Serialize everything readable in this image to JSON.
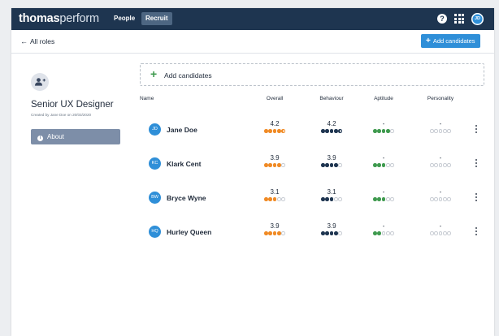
{
  "header": {
    "brand_bold": "thomas",
    "brand_light": "perform",
    "nav_people": "People",
    "nav_recruit": "Recruit",
    "user_initials": "JD"
  },
  "subbar": {
    "back_label": "All roles",
    "add_button_label": "Add candidates"
  },
  "role": {
    "title": "Senior UX Designer",
    "created": "Created by Jane Doe on 20/03/2020",
    "about_label": "About"
  },
  "add_candidates_label": "Add candidates",
  "table": {
    "headers": {
      "name": "Name",
      "overall": "Overall",
      "behaviour": "Behaviour",
      "aptitude": "Aptitude",
      "personality": "Personality"
    },
    "rows": [
      {
        "initials": "JD",
        "name": "Jane Doe",
        "overall": "4.2",
        "overall_level": 4.5,
        "behaviour": "4.2",
        "behaviour_level": 4.5,
        "aptitude": "-",
        "aptitude_level": 4,
        "personality": "-",
        "personality_level": 0
      },
      {
        "initials": "KC",
        "name": "Klark Cent",
        "overall": "3.9",
        "overall_level": 4,
        "behaviour": "3.9",
        "behaviour_level": 4,
        "aptitude": "-",
        "aptitude_level": 3,
        "personality": "-",
        "personality_level": 0
      },
      {
        "initials": "BW",
        "name": "Bryce Wyne",
        "overall": "3.1",
        "overall_level": 3,
        "behaviour": "3.1",
        "behaviour_level": 3,
        "aptitude": "-",
        "aptitude_level": 3,
        "personality": "-",
        "personality_level": 0
      },
      {
        "initials": "HQ",
        "name": "Hurley Queen",
        "overall": "3.9",
        "overall_level": 4,
        "behaviour": "3.9",
        "behaviour_level": 4,
        "aptitude": "-",
        "aptitude_level": 2,
        "personality": "-",
        "personality_level": 0
      }
    ]
  },
  "colors": {
    "topbar": "#1e3550",
    "accent_blue": "#2f8fd8",
    "overall_dots": "#f08a24",
    "behaviour_dots": "#1e3550",
    "aptitude_dots": "#3f9a4e",
    "empty_dots": "#c7ccd3",
    "about_button": "#7d8ea8"
  }
}
